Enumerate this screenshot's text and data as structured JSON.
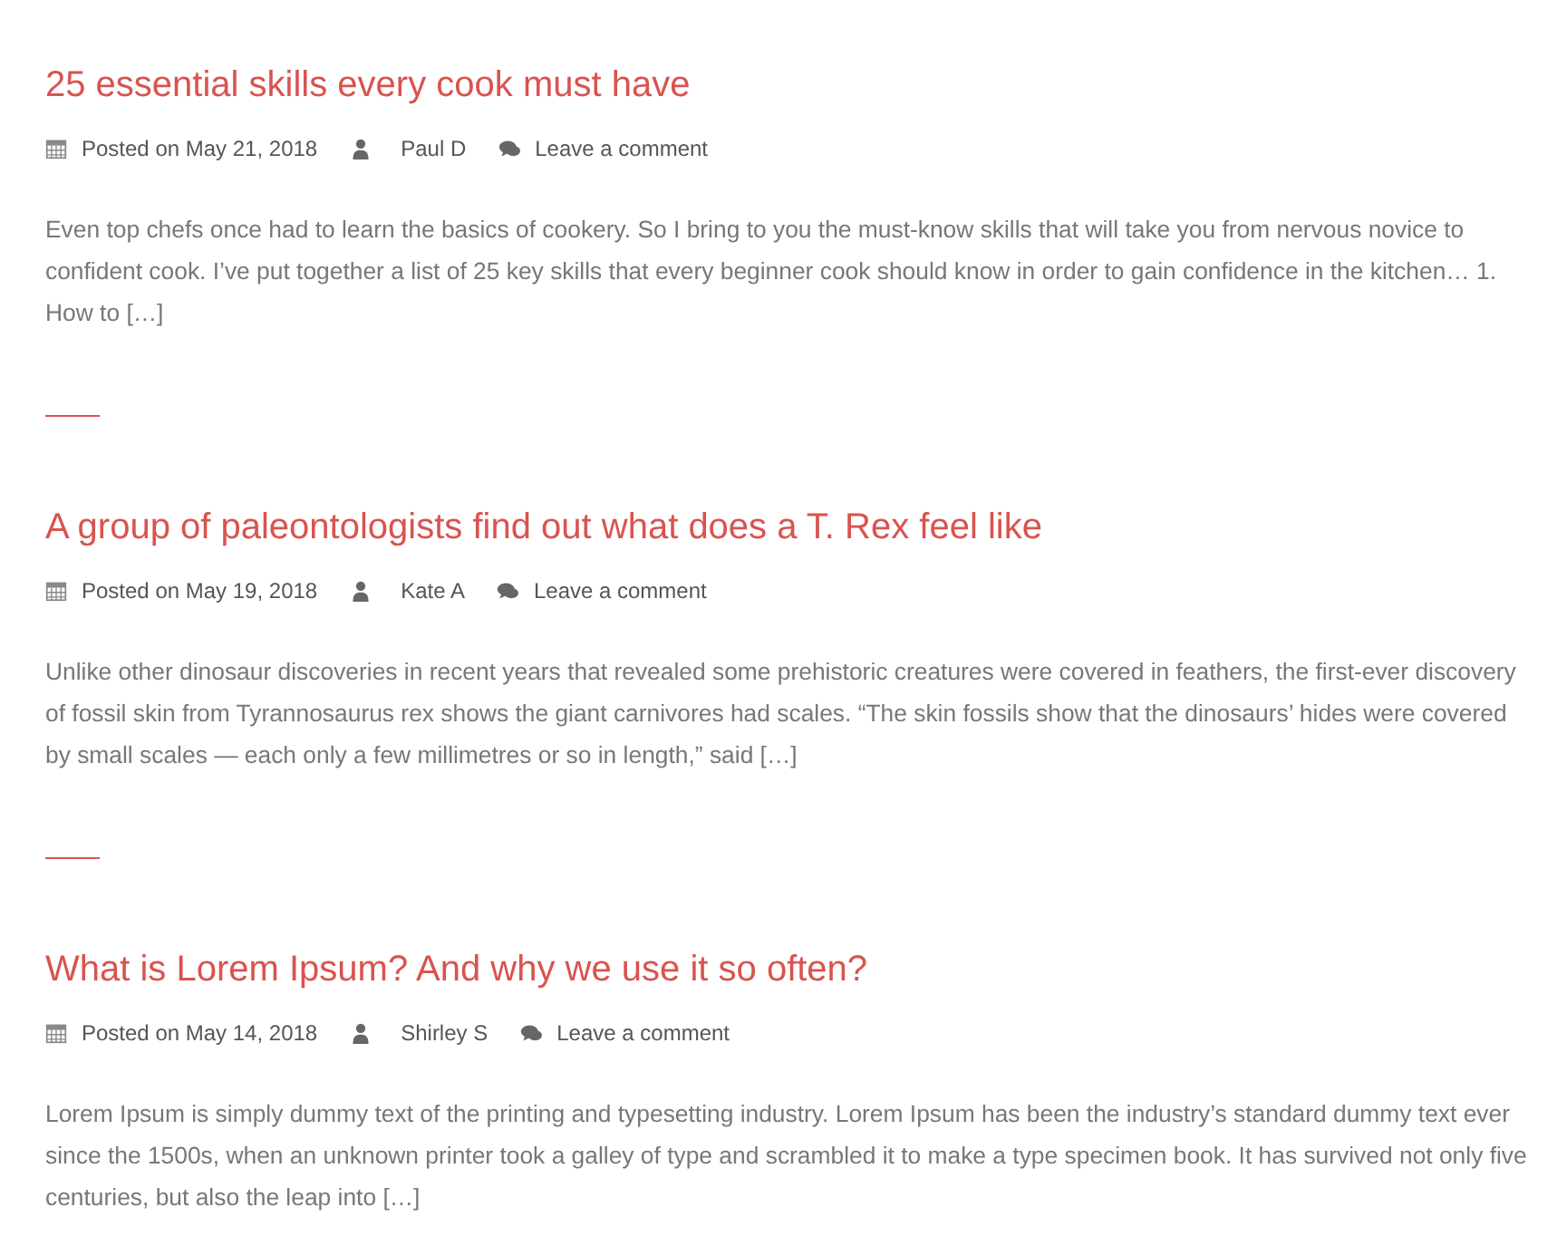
{
  "posts": [
    {
      "title": "25 essential skills every cook must have",
      "posted": "Posted on May 21, 2018",
      "author": "Paul D",
      "comments": "Leave a comment",
      "excerpt": "Even top chefs once had to learn the basics of cookery. So I bring to you the must-know skills that will take you from nervous novice to confident cook. I’ve put together a list of 25 key skills that every beginner cook should know in order to gain confidence in the kitchen… 1. How to […]"
    },
    {
      "title": "A group of paleontologists find out what does a T. Rex feel like",
      "posted": "Posted on May 19, 2018",
      "author": "Kate A",
      "comments": "Leave a comment",
      "excerpt": "Unlike other dinosaur discoveries in recent years that revealed some prehistoric creatures were covered in feathers, the first-ever discovery of fossil skin from Tyrannosaurus rex shows the giant carnivores had scales. “The skin fossils show that the dinosaurs’ hides were covered by small scales — each only a few millimetres or so in length,” said […]"
    },
    {
      "title": "What is Lorem Ipsum? And why we use it so often?",
      "posted": "Posted on May 14, 2018",
      "author": "Shirley S",
      "comments": "Leave a comment",
      "excerpt": "Lorem Ipsum is simply dummy text of the printing and typesetting industry. Lorem Ipsum has been the industry’s standard dummy text ever since the 1500s, when an unknown printer took a galley of type and scrambled it to make a type specimen book. It has survived not only five centuries, but also the leap into […]"
    }
  ]
}
